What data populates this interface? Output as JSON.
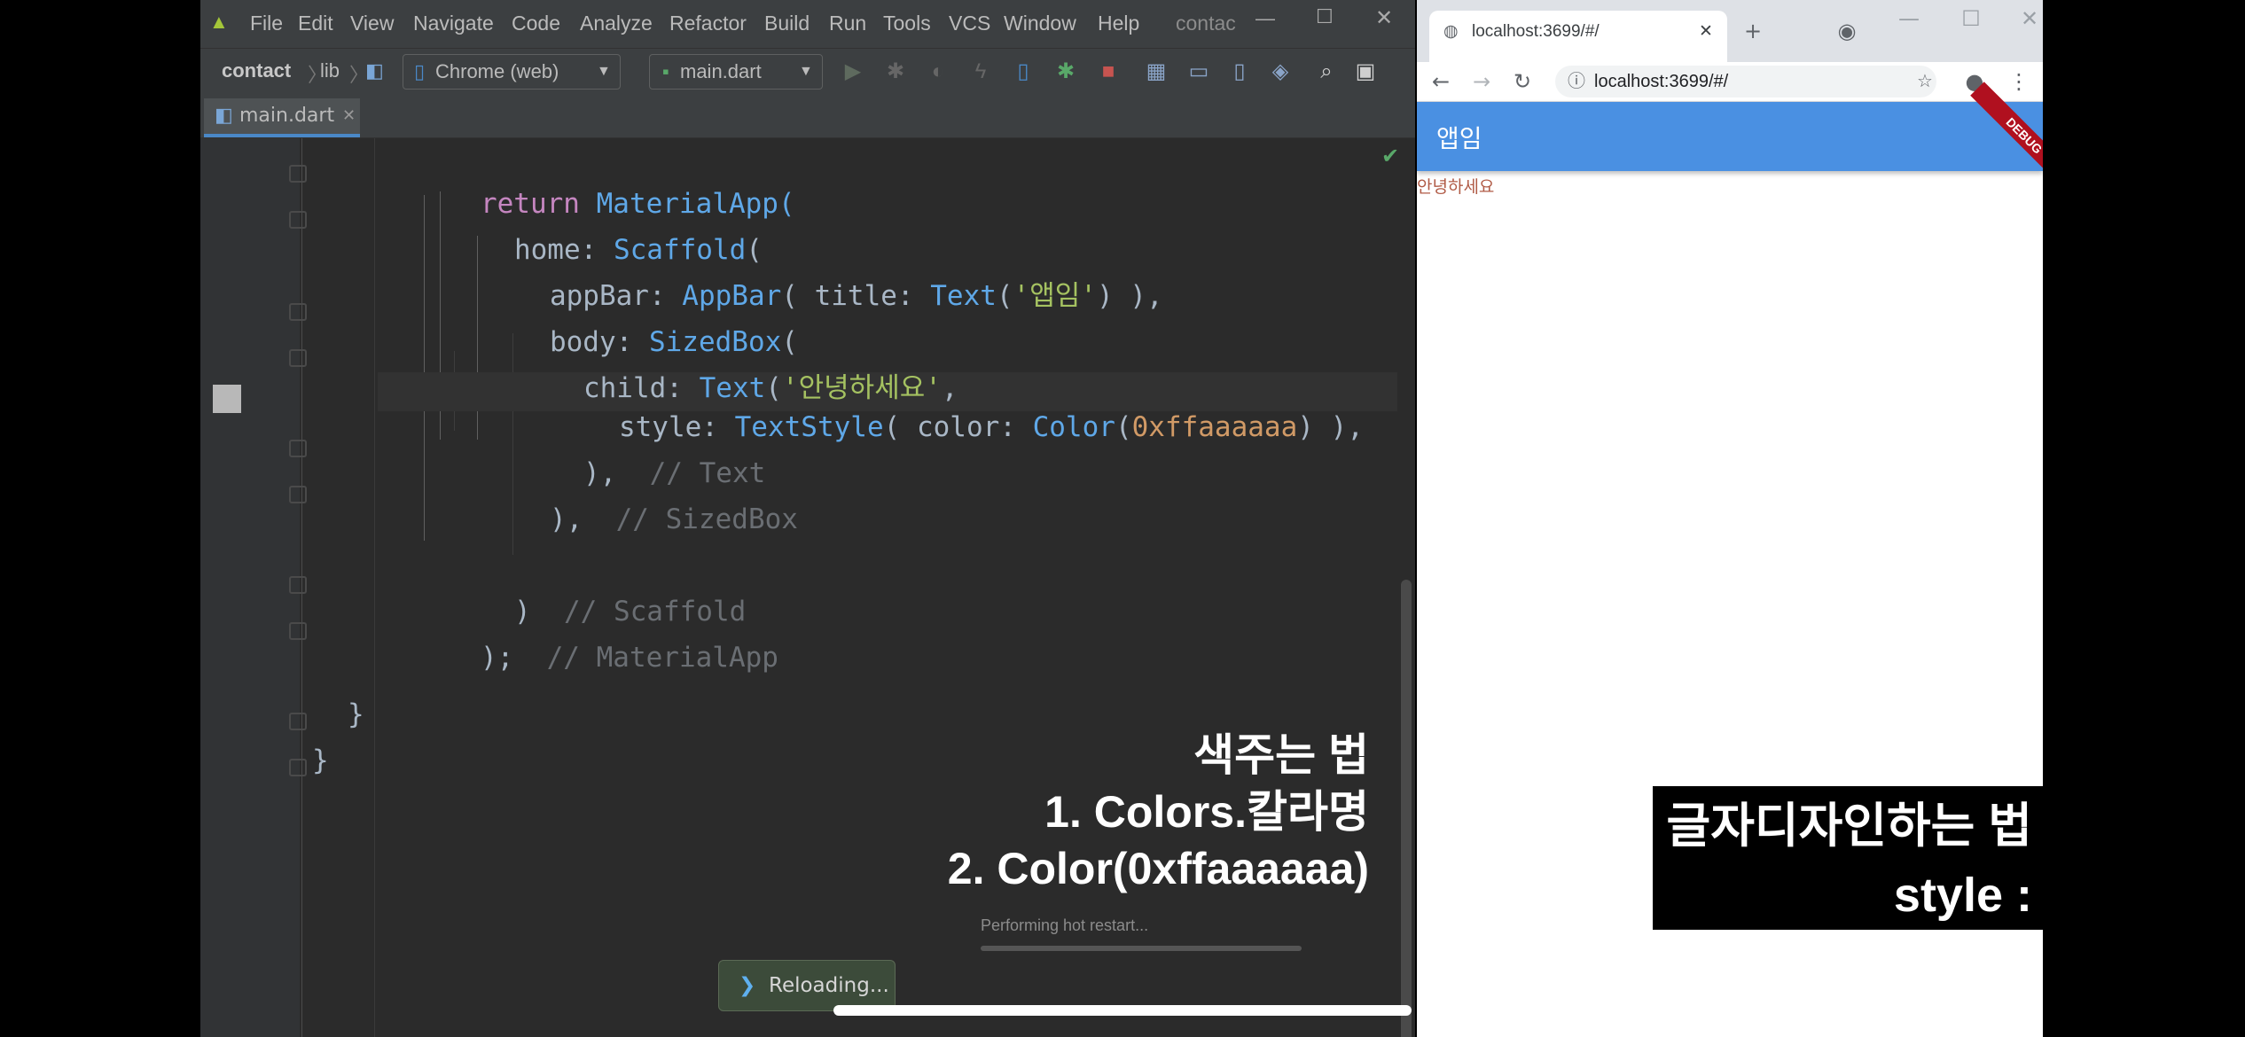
{
  "ide": {
    "menu": [
      "File",
      "Edit",
      "View",
      "Navigate",
      "Code",
      "Analyze",
      "Refactor",
      "Build",
      "Run",
      "Tools",
      "VCS",
      "Window",
      "Help"
    ],
    "window_title_partial": "contac",
    "breadcrumb": [
      "contact",
      "lib"
    ],
    "device_selector": "Chrome (web)",
    "config_selector": "main.dart",
    "tab": "main.dart",
    "code": {
      "l1": [
        "return",
        " MaterialApp("
      ],
      "l2": [
        "home: ",
        "Scaffold",
        "("
      ],
      "l3": [
        "appBar: ",
        "AppBar",
        "( title: ",
        "Text",
        "(",
        "'앱임'",
        ") ),"
      ],
      "l4": [
        "body: ",
        "SizedBox",
        "("
      ],
      "l5": [
        "child: ",
        "Text",
        "(",
        "'안녕하세요'",
        ","
      ],
      "l6": [
        "style: ",
        "TextStyle",
        "( color: ",
        "Color",
        "(",
        "0xffaaaaaa",
        ") ),"
      ],
      "l7": [
        "),  ",
        "// Text"
      ],
      "l8": [
        "),  ",
        "// SizedBox"
      ],
      "l9": [
        ")  ",
        "// Scaffold"
      ],
      "l10": [
        ");  ",
        "// MaterialApp"
      ],
      "l11": "}",
      "l12": "}"
    },
    "overlay": [
      "색주는 법",
      "1. Colors.칼라명",
      "2. Color(0xffaaaaaa)"
    ],
    "progress_text": "Performing hot restart...",
    "reloading_label": "Reloading..."
  },
  "browser": {
    "tab_title": "localhost:3699/#/",
    "url": "localhost:3699/#/",
    "app_title": "앱임",
    "debug_badge": "DEBUG",
    "body_text": "안녕하세요",
    "body_text_color": "#b05a45"
  },
  "caption": [
    "글자디자인하는 법",
    "style : TextStyle()"
  ],
  "colors": {
    "appbar": "#4a90e2",
    "ide_bg": "#2b2b2b",
    "ide_chrome": "#3c3f41"
  }
}
